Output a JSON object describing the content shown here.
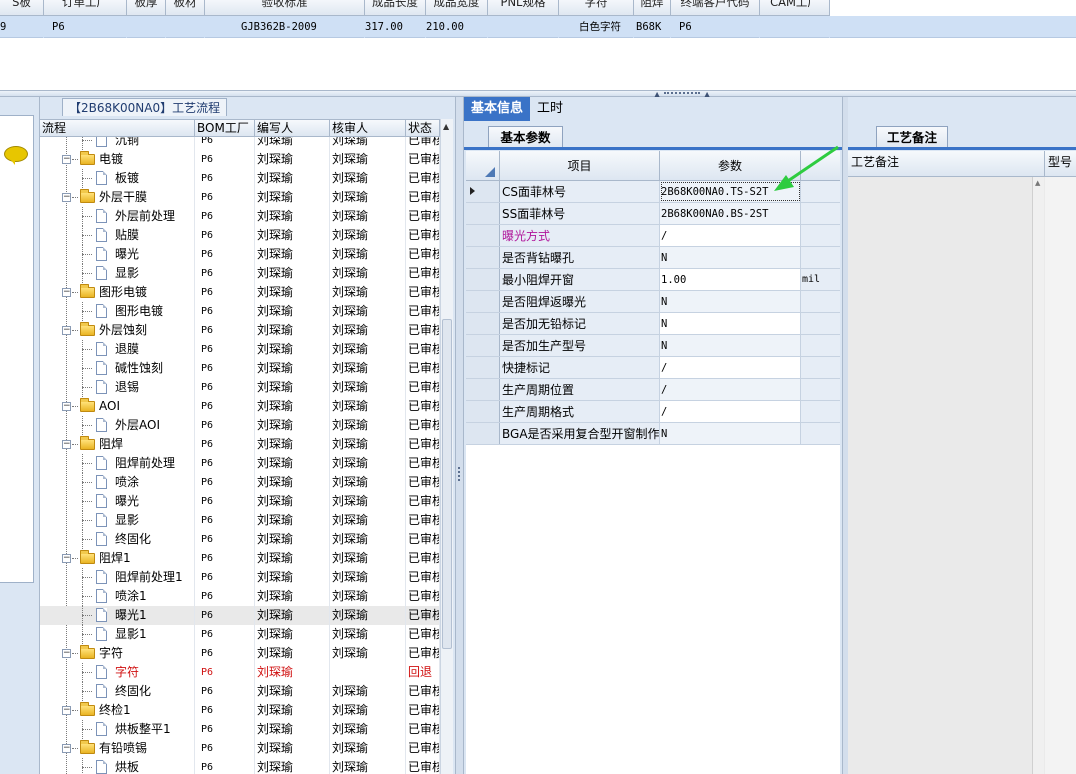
{
  "top_grid": {
    "headers": [
      "S板",
      "订单工厂",
      "板厚",
      "板材",
      "验收标准",
      "成品长度",
      "成品宽度",
      "PNL规格",
      "字符",
      "阻焊",
      "终端客户代码",
      "CAM工厂"
    ],
    "row": [
      "9",
      "P6",
      "",
      "",
      "GJB362B-2009",
      "317.00",
      "210.00",
      "",
      "白色字符",
      "B68K",
      "P6",
      ""
    ]
  },
  "tree_panel": {
    "title": "【2B68K00NA0】工艺流程",
    "columns": [
      "流程",
      "BOM工厂",
      "编写人",
      "核审人",
      "状态"
    ],
    "rows": [
      {
        "name": "沉铜",
        "level": 2,
        "bom": "P6",
        "author": "刘琛瑜",
        "reviewer": "刘琛瑜",
        "status": "已审核"
      },
      {
        "name": "电镀",
        "level": 1,
        "bom": "P6",
        "author": "刘琛瑜",
        "reviewer": "刘琛瑜",
        "status": "已审核"
      },
      {
        "name": "板镀",
        "level": 2,
        "bom": "P6",
        "author": "刘琛瑜",
        "reviewer": "刘琛瑜",
        "status": "已审核"
      },
      {
        "name": "外层干膜",
        "level": 1,
        "bom": "P6",
        "author": "刘琛瑜",
        "reviewer": "刘琛瑜",
        "status": "已审核"
      },
      {
        "name": "外层前处理",
        "level": 2,
        "bom": "P6",
        "author": "刘琛瑜",
        "reviewer": "刘琛瑜",
        "status": "已审核"
      },
      {
        "name": "贴膜",
        "level": 2,
        "bom": "P6",
        "author": "刘琛瑜",
        "reviewer": "刘琛瑜",
        "status": "已审核"
      },
      {
        "name": "曝光",
        "level": 2,
        "bom": "P6",
        "author": "刘琛瑜",
        "reviewer": "刘琛瑜",
        "status": "已审核"
      },
      {
        "name": "显影",
        "level": 2,
        "bom": "P6",
        "author": "刘琛瑜",
        "reviewer": "刘琛瑜",
        "status": "已审核"
      },
      {
        "name": "图形电镀",
        "level": 1,
        "bom": "P6",
        "author": "刘琛瑜",
        "reviewer": "刘琛瑜",
        "status": "已审核"
      },
      {
        "name": "图形电镀",
        "level": 2,
        "bom": "P6",
        "author": "刘琛瑜",
        "reviewer": "刘琛瑜",
        "status": "已审核"
      },
      {
        "name": "外层蚀刻",
        "level": 1,
        "bom": "P6",
        "author": "刘琛瑜",
        "reviewer": "刘琛瑜",
        "status": "已审核"
      },
      {
        "name": "退膜",
        "level": 2,
        "bom": "P6",
        "author": "刘琛瑜",
        "reviewer": "刘琛瑜",
        "status": "已审核"
      },
      {
        "name": "碱性蚀刻",
        "level": 2,
        "bom": "P6",
        "author": "刘琛瑜",
        "reviewer": "刘琛瑜",
        "status": "已审核"
      },
      {
        "name": "退锡",
        "level": 2,
        "bom": "P6",
        "author": "刘琛瑜",
        "reviewer": "刘琛瑜",
        "status": "已审核"
      },
      {
        "name": "AOI",
        "level": 1,
        "bom": "P6",
        "author": "刘琛瑜",
        "reviewer": "刘琛瑜",
        "status": "已审核"
      },
      {
        "name": "外层AOI",
        "level": 2,
        "bom": "P6",
        "author": "刘琛瑜",
        "reviewer": "刘琛瑜",
        "status": "已审核"
      },
      {
        "name": "阻焊",
        "level": 1,
        "bom": "P6",
        "author": "刘琛瑜",
        "reviewer": "刘琛瑜",
        "status": "已审核"
      },
      {
        "name": "阻焊前处理",
        "level": 2,
        "bom": "P6",
        "author": "刘琛瑜",
        "reviewer": "刘琛瑜",
        "status": "已审核"
      },
      {
        "name": "喷涂",
        "level": 2,
        "bom": "P6",
        "author": "刘琛瑜",
        "reviewer": "刘琛瑜",
        "status": "已审核"
      },
      {
        "name": "曝光",
        "level": 2,
        "bom": "P6",
        "author": "刘琛瑜",
        "reviewer": "刘琛瑜",
        "status": "已审核"
      },
      {
        "name": "显影",
        "level": 2,
        "bom": "P6",
        "author": "刘琛瑜",
        "reviewer": "刘琛瑜",
        "status": "已审核"
      },
      {
        "name": "终固化",
        "level": 2,
        "bom": "P6",
        "author": "刘琛瑜",
        "reviewer": "刘琛瑜",
        "status": "已审核"
      },
      {
        "name": "阻焊1",
        "level": 1,
        "bom": "P6",
        "author": "刘琛瑜",
        "reviewer": "刘琛瑜",
        "status": "已审核"
      },
      {
        "name": "阻焊前处理1",
        "level": 2,
        "bom": "P6",
        "author": "刘琛瑜",
        "reviewer": "刘琛瑜",
        "status": "已审核"
      },
      {
        "name": "喷涂1",
        "level": 2,
        "bom": "P6",
        "author": "刘琛瑜",
        "reviewer": "刘琛瑜",
        "status": "已审核"
      },
      {
        "name": "曝光1",
        "level": 2,
        "bom": "P6",
        "author": "刘琛瑜",
        "reviewer": "刘琛瑜",
        "status": "已审核",
        "selected": true
      },
      {
        "name": "显影1",
        "level": 2,
        "bom": "P6",
        "author": "刘琛瑜",
        "reviewer": "刘琛瑜",
        "status": "已审核"
      },
      {
        "name": "字符",
        "level": 1,
        "bom": "P6",
        "author": "刘琛瑜",
        "reviewer": "刘琛瑜",
        "status": "已审核"
      },
      {
        "name": "字符",
        "level": 2,
        "bom": "P6",
        "author": "刘琛瑜",
        "reviewer": "",
        "status": "回退",
        "red": true
      },
      {
        "name": "终固化",
        "level": 2,
        "bom": "P6",
        "author": "刘琛瑜",
        "reviewer": "刘琛瑜",
        "status": "已审核"
      },
      {
        "name": "终检1",
        "level": 1,
        "bom": "P6",
        "author": "刘琛瑜",
        "reviewer": "刘琛瑜",
        "status": "已审核"
      },
      {
        "name": "烘板整平1",
        "level": 2,
        "bom": "P6",
        "author": "刘琛瑜",
        "reviewer": "刘琛瑜",
        "status": "已审核"
      },
      {
        "name": "有铅喷锡",
        "level": 1,
        "bom": "P6",
        "author": "刘琛瑜",
        "reviewer": "刘琛瑜",
        "status": "已审核"
      },
      {
        "name": "烘板",
        "level": 2,
        "bom": "P6",
        "author": "刘琛瑜",
        "reviewer": "刘琛瑜",
        "status": "已审核"
      }
    ]
  },
  "mid_panel": {
    "tabs": [
      "基本信息",
      "工时"
    ],
    "subtab": "基本参数",
    "columns": [
      "项目",
      "参数"
    ],
    "params": [
      {
        "key": "CS面菲林号",
        "value": "2B68K00NA0.TS-S2T",
        "unit": "",
        "current": true
      },
      {
        "key": "SS面菲林号",
        "value": "2B68K00NA0.BS-2ST",
        "unit": ""
      },
      {
        "key": "曝光方式",
        "value": "/",
        "unit": "",
        "purple": true
      },
      {
        "key": "是否背钻曝孔",
        "value": "N",
        "unit": ""
      },
      {
        "key": "最小阻焊开窗",
        "value": "1.00",
        "unit": "mil"
      },
      {
        "key": "是否阻焊返曝光",
        "value": "N",
        "unit": ""
      },
      {
        "key": "是否加无铅标记",
        "value": "N",
        "unit": ""
      },
      {
        "key": "是否加生产型号",
        "value": "N",
        "unit": ""
      },
      {
        "key": "快捷标记",
        "value": "/",
        "unit": ""
      },
      {
        "key": "生产周期位置",
        "value": "/",
        "unit": ""
      },
      {
        "key": "生产周期格式",
        "value": "/",
        "unit": ""
      },
      {
        "key": "BGA是否采用复合型开窗制作",
        "value": "N",
        "unit": ""
      }
    ]
  },
  "right_panel": {
    "subtab": "工艺备注",
    "columns": [
      "工艺备注",
      "型号"
    ]
  },
  "colors": {
    "accent_tab": "#3a73c7",
    "selected_row": "#cfe0f5",
    "annotation_arrow": "#2ecc40",
    "reject_red": "#d01010",
    "purple_label": "#b0169b"
  }
}
